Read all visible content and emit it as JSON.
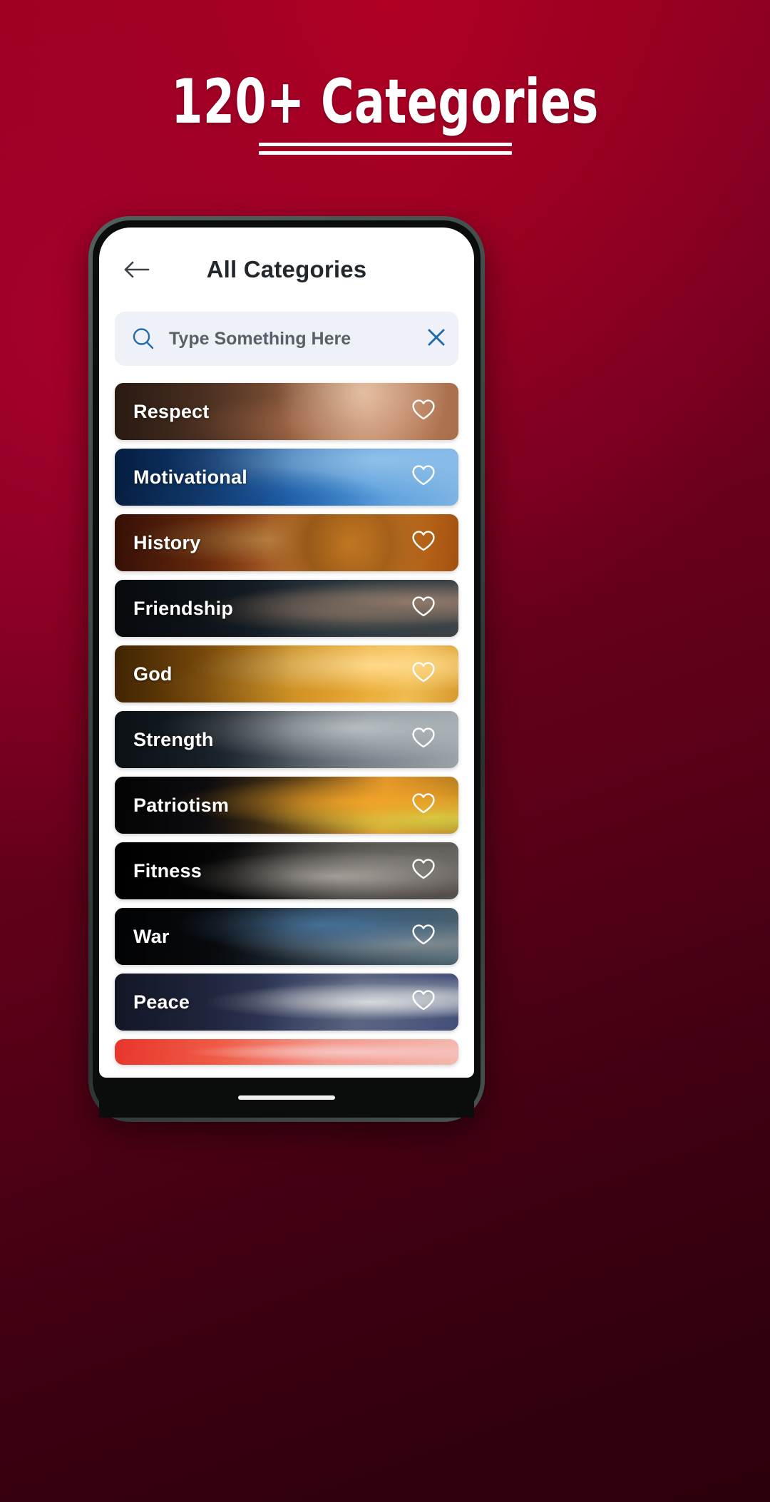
{
  "promo": {
    "headline": "120+ Categories"
  },
  "app": {
    "header": {
      "back_icon": "arrow-left-icon",
      "title": "All Categories"
    },
    "search": {
      "icon": "search-icon",
      "value": "",
      "placeholder": "Type Something Here",
      "clear_icon": "close-icon",
      "accent_color": "#1f6bb0",
      "background_color": "#eef1f7"
    },
    "categories": [
      {
        "label": "Respect",
        "art": "art-respect",
        "fav_icon": "heart-outline-icon"
      },
      {
        "label": "Motivational",
        "art": "art-motivational",
        "fav_icon": "heart-outline-icon"
      },
      {
        "label": "History",
        "art": "art-history",
        "fav_icon": "heart-outline-icon"
      },
      {
        "label": "Friendship",
        "art": "art-friendship",
        "fav_icon": "heart-outline-icon"
      },
      {
        "label": "God",
        "art": "art-god",
        "fav_icon": "heart-outline-icon"
      },
      {
        "label": "Strength",
        "art": "art-strength",
        "fav_icon": "heart-outline-icon"
      },
      {
        "label": "Patriotism",
        "art": "art-patriotism",
        "fav_icon": "heart-outline-icon"
      },
      {
        "label": "Fitness",
        "art": "art-fitness",
        "fav_icon": "heart-outline-icon"
      },
      {
        "label": "War",
        "art": "art-war",
        "fav_icon": "heart-outline-icon"
      },
      {
        "label": "Peace",
        "art": "art-peace",
        "fav_icon": "heart-outline-icon"
      },
      {
        "label": "",
        "art": "art-partial",
        "fav_icon": ""
      }
    ],
    "home_indicator": true
  },
  "colors": {
    "background_red": "#7e0021",
    "title_white": "#ffffff",
    "header_text": "#22272b",
    "search_text": "#5a6069"
  }
}
